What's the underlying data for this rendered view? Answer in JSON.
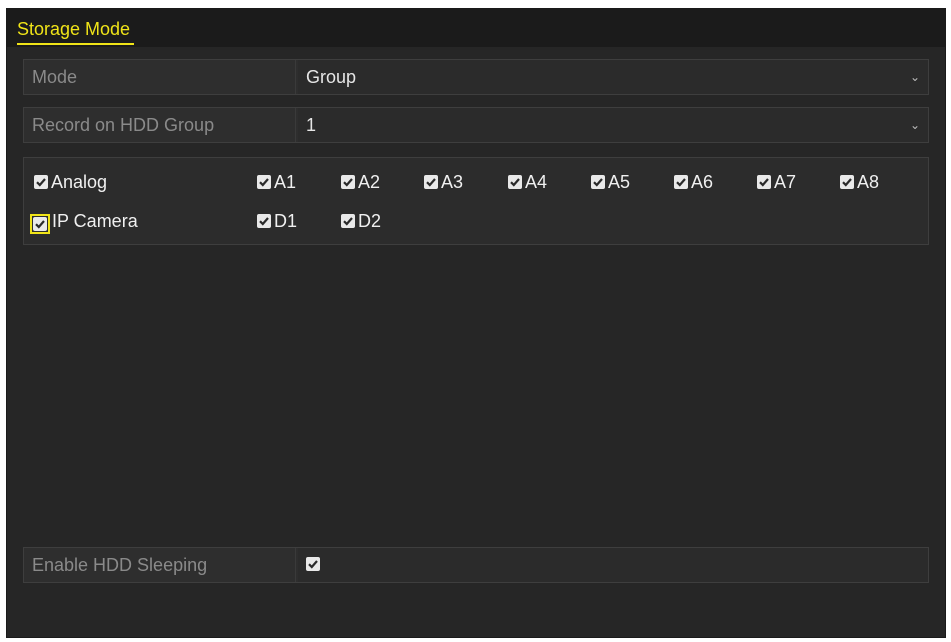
{
  "window": {
    "tab": "Storage Mode"
  },
  "fields": {
    "mode": {
      "label": "Mode",
      "value": "Group"
    },
    "hdd_group": {
      "label": "Record on HDD Group",
      "value": "1"
    },
    "hdd_sleeping": {
      "label": "Enable HDD Sleeping",
      "checked": true
    }
  },
  "cameras": {
    "analog": {
      "label": "Analog",
      "checked": true,
      "channels": [
        {
          "label": "A1",
          "checked": true
        },
        {
          "label": "A2",
          "checked": true
        },
        {
          "label": "A3",
          "checked": true
        },
        {
          "label": "A4",
          "checked": true
        },
        {
          "label": "A5",
          "checked": true
        },
        {
          "label": "A6",
          "checked": true
        },
        {
          "label": "A7",
          "checked": true
        },
        {
          "label": "A8",
          "checked": true
        }
      ]
    },
    "ip": {
      "label": "IP Camera",
      "checked": true,
      "channels": [
        {
          "label": "D1",
          "checked": true
        },
        {
          "label": "D2",
          "checked": true
        }
      ]
    }
  },
  "icons": {
    "checkbox": "check-icon",
    "dropdown": "chevron-down-icon"
  },
  "colors": {
    "accent": "#f0e418",
    "background": "#262626"
  }
}
